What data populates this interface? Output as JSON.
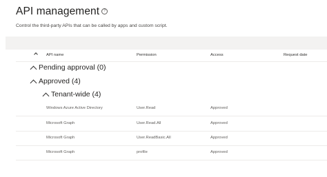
{
  "header": {
    "title": "API management",
    "info_icon": "info-icon",
    "description": "Control the third-party APIs that can be called by apps and custom script."
  },
  "table": {
    "columns": {
      "api_name": "API name",
      "permission": "Permission",
      "access": "Access",
      "request_date": "Request date"
    },
    "groups": {
      "pending": "Pending approval (0)",
      "approved": "Approved (4)",
      "tenant_wide": "Tenant-wide (4)"
    },
    "rows": [
      {
        "api_name": "Windows Azure Active Directory",
        "permission": "User.Read",
        "access": "Approved",
        "request_date": ""
      },
      {
        "api_name": "Microsoft Graph",
        "permission": "User.Read.All",
        "access": "Approved",
        "request_date": ""
      },
      {
        "api_name": "Microsoft Graph",
        "permission": "User.ReadBasic.All",
        "access": "Approved",
        "request_date": ""
      },
      {
        "api_name": "Microsoft Graph",
        "permission": "profile",
        "access": "Approved",
        "request_date": ""
      }
    ]
  },
  "colors": {
    "command_bar_bg": "#f3f2f1",
    "divider": "#edebe9",
    "text_primary": "#201f1e",
    "text_secondary": "#605e5c"
  }
}
